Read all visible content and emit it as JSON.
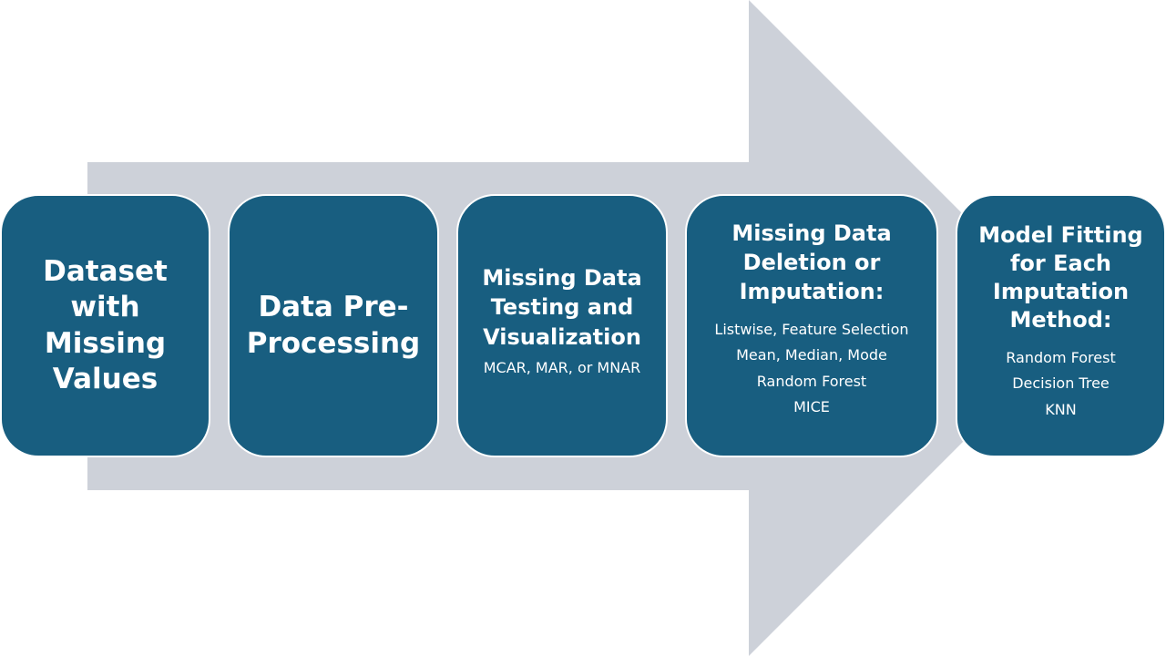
{
  "arrow": {
    "fill": "#cdd1d9"
  },
  "step_color": "#185e80",
  "steps": [
    {
      "title": "Dataset with Missing Values",
      "items": []
    },
    {
      "title": "Data Pre-Processing",
      "items": []
    },
    {
      "title": "Missing Data Testing and Visualization",
      "items": [
        "MCAR, MAR, or MNAR"
      ]
    },
    {
      "title": "Missing Data Deletion or Imputation:",
      "items": [
        "Listwise, Feature Selection",
        "Mean, Median, Mode",
        "Random Forest",
        "MICE"
      ]
    },
    {
      "title": "Model Fitting for Each Imputation Method:",
      "items": [
        "Random Forest",
        "Decision Tree",
        "KNN"
      ]
    }
  ]
}
